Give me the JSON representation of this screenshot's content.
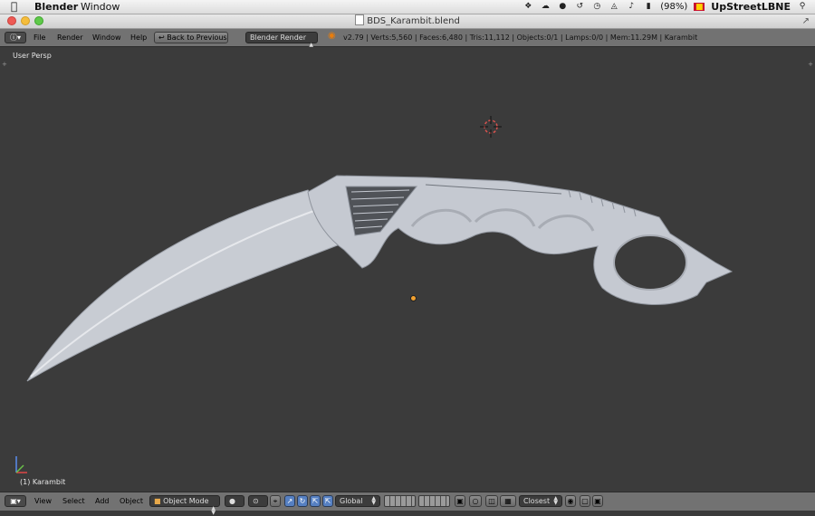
{
  "macos_menubar": {
    "app_name": "Blender",
    "menus": [
      "Window"
    ],
    "battery": "(98%)",
    "user": "UpStreetLBNE"
  },
  "window": {
    "title": "BDS_Karambit.blend"
  },
  "info_header": {
    "menus": [
      "File",
      "Render",
      "Window",
      "Help"
    ],
    "back_button": "Back to Previous",
    "render_engine": "Blender Render",
    "stats": "v2.79 | Verts:5,560 | Faces:6,480 | Tris:11,112 | Objects:0/1 | Lamps:0/0 | Mem:11.29M | Karambit"
  },
  "viewport": {
    "view_label": "User Persp",
    "object_label": "(1) Karambit"
  },
  "view3d_header": {
    "menus": [
      "View",
      "Select",
      "Add",
      "Object"
    ],
    "mode": "Object Mode",
    "orientation": "Global",
    "snap_target": "Closest"
  },
  "colors": {
    "viewport_bg": "#3b3b3b",
    "header_bg": "#727272",
    "mesh": "#c9ccd2",
    "cursor": "#d9534f",
    "origin": "#f0a030"
  }
}
